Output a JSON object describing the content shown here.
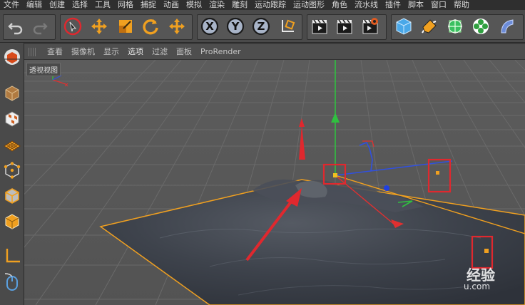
{
  "menubar": {
    "items": [
      "文件",
      "编辑",
      "创建",
      "选择",
      "工具",
      "网格",
      "捕捉",
      "动画",
      "模拟",
      "渲染",
      "雕刻",
      "运动跟踪",
      "运动图形",
      "角色",
      "流水线",
      "插件",
      "脚本",
      "窗口",
      "帮助"
    ]
  },
  "toolbar": {
    "undo": "undo-icon",
    "redo": "redo-icon",
    "axis_x": "X",
    "axis_y": "Y",
    "axis_z": "Z"
  },
  "viewport_menu": {
    "items": [
      "查看",
      "摄像机",
      "显示",
      "选项",
      "过滤",
      "面板",
      "ProRender"
    ],
    "active_index": 3
  },
  "viewport": {
    "label": "透视视图"
  },
  "watermark": {
    "line1": "经验",
    "line2": "u.com"
  },
  "colors": {
    "accent_orange": "#f0a020",
    "annotation_red": "#e0282e",
    "axis_x": "#e03030",
    "axis_y": "#30c040",
    "axis_z": "#3050e0",
    "viewport_bg": "#595959"
  }
}
